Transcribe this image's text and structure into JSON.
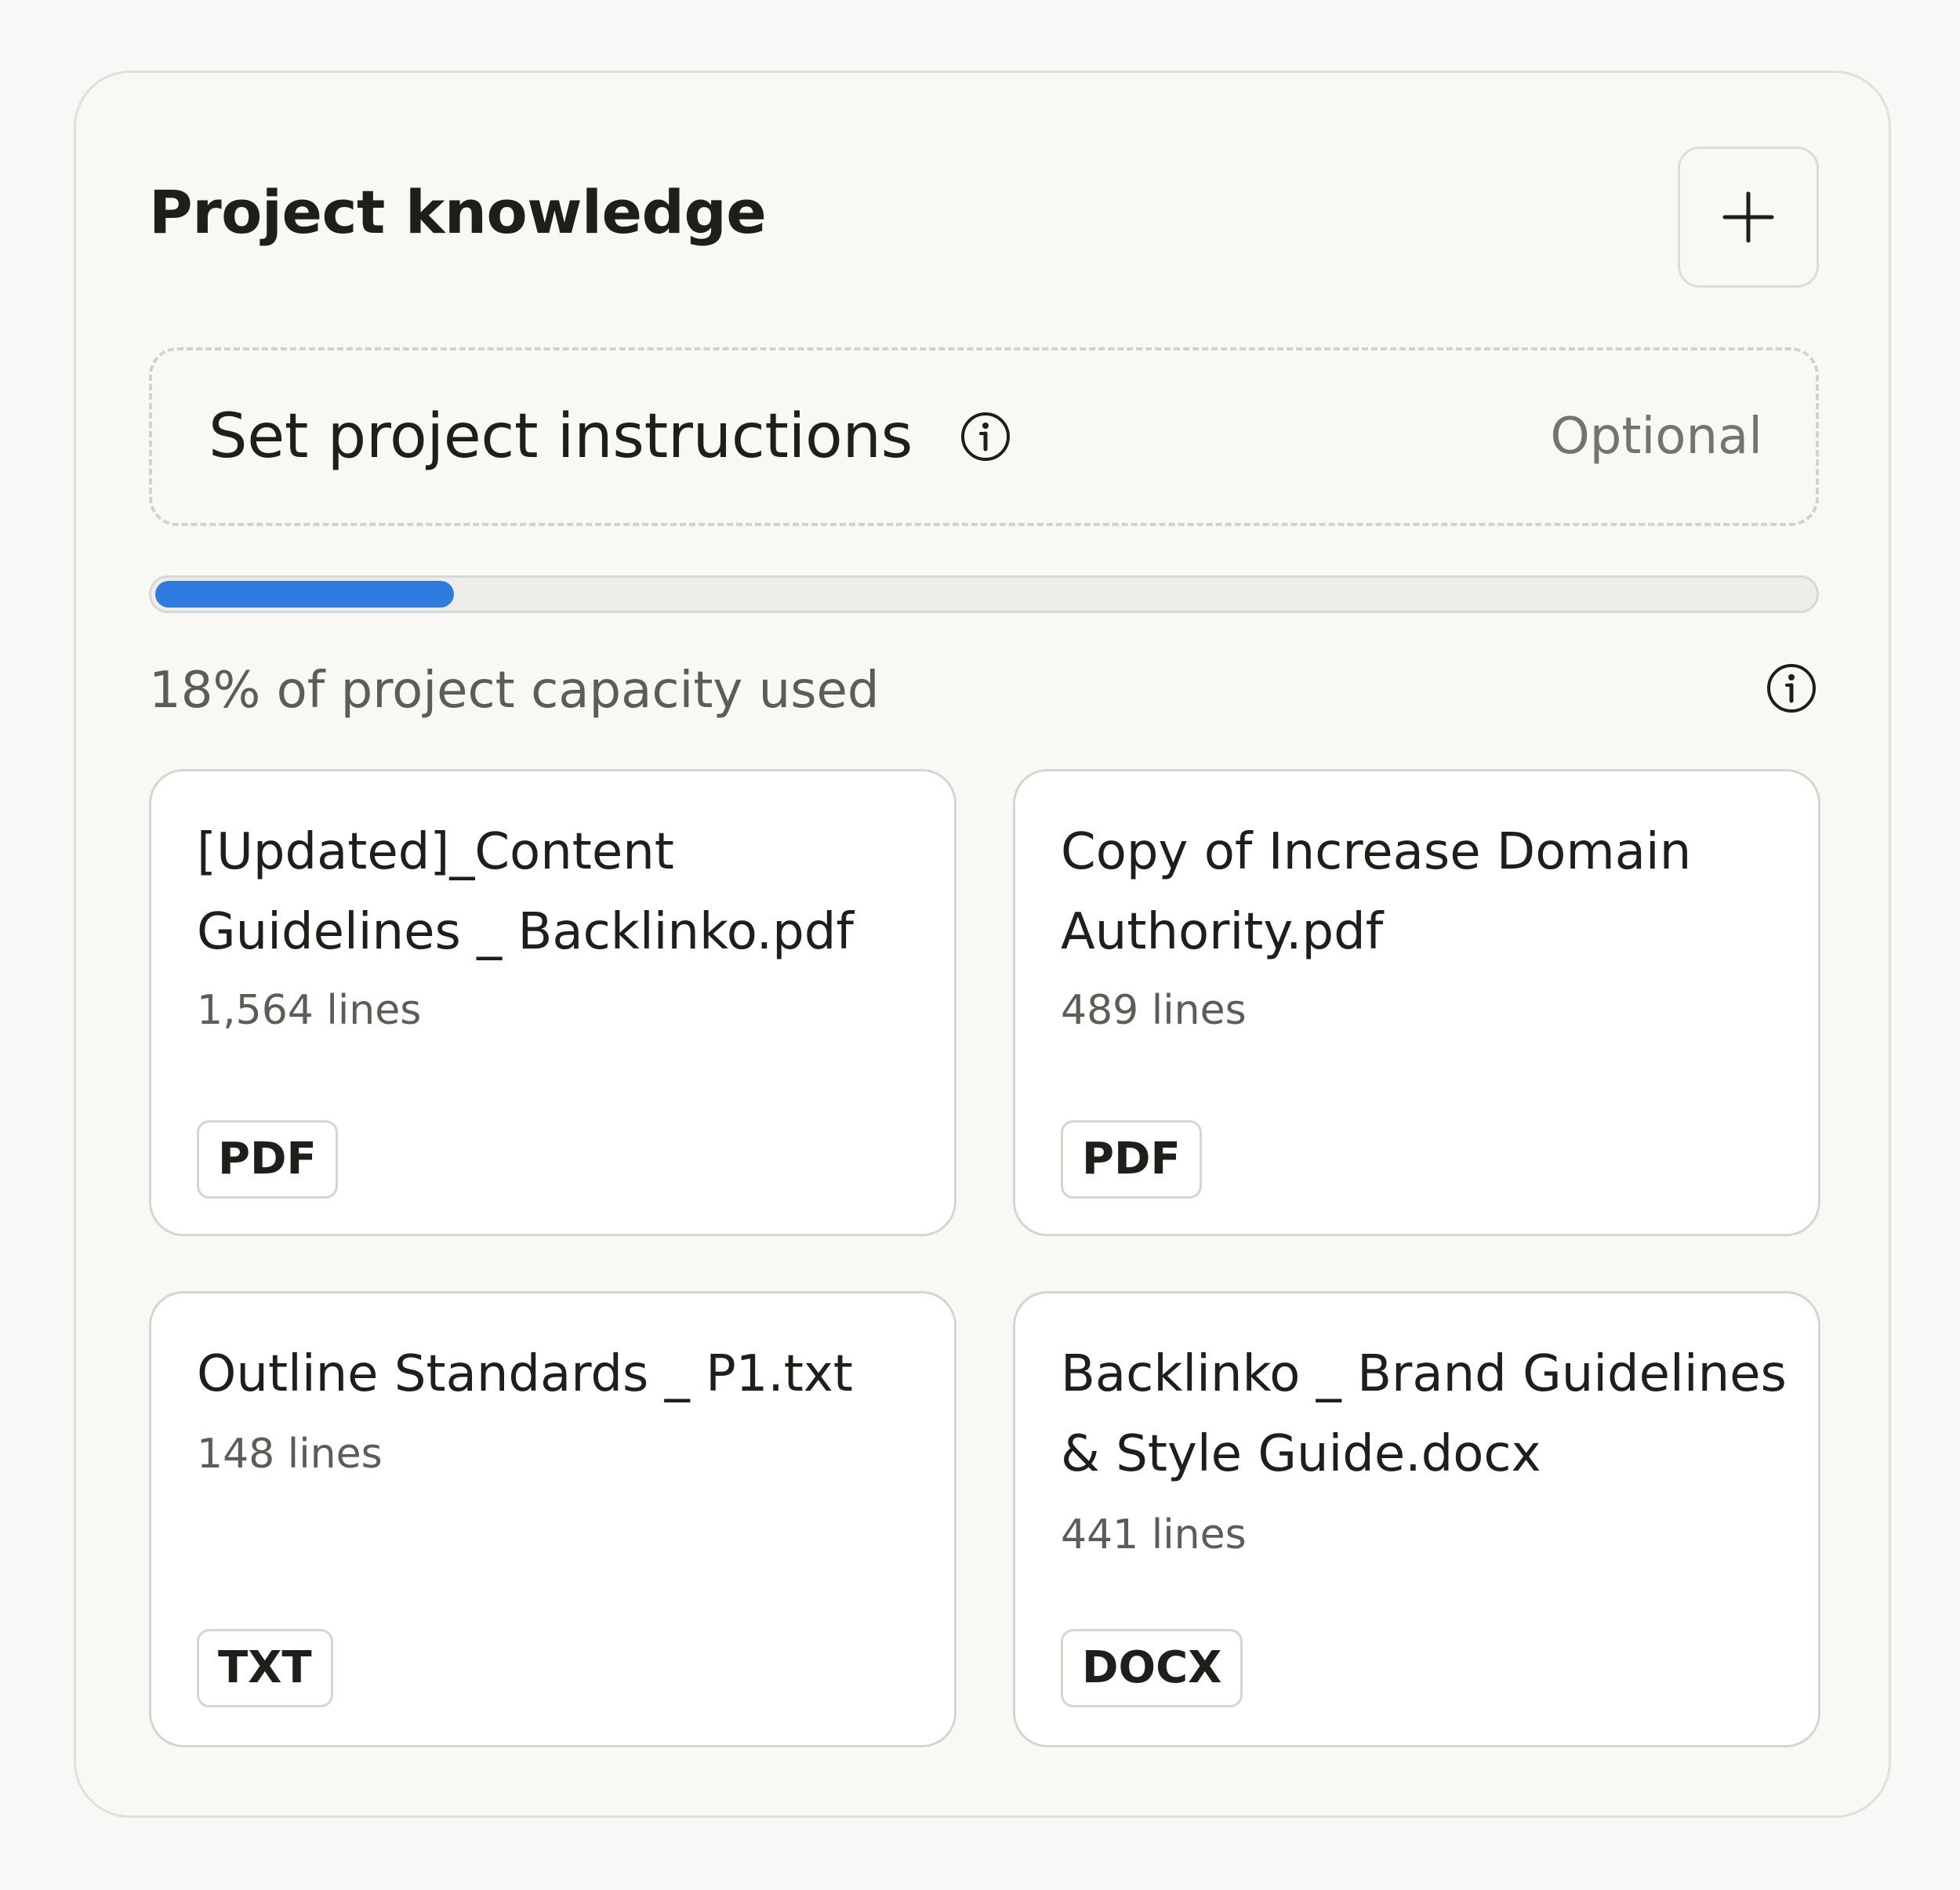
{
  "panel": {
    "title": "Project knowledge",
    "add_button_icon": "plus-icon"
  },
  "instructions": {
    "label": "Set project instructions",
    "info_icon": "info-icon",
    "optional_text": "Optional"
  },
  "capacity": {
    "percent_used": 18,
    "text": "18% of project capacity used",
    "info_icon": "info-icon",
    "bar_color": "#2e7ce0"
  },
  "files": [
    {
      "name": "[Updated]_Content Guidelines _ Backlinko.pdf",
      "lines": "1,564 lines",
      "type": "PDF"
    },
    {
      "name": "Copy of Increase Domain Authority.pdf",
      "lines": "489 lines",
      "type": "PDF"
    },
    {
      "name": "Outline Standards _ P1.txt",
      "lines": "148 lines",
      "type": "TXT"
    },
    {
      "name": "Backlinko _ Brand Guidelines & Style Guide.docx",
      "lines": "441 lines",
      "type": "DOCX"
    }
  ]
}
